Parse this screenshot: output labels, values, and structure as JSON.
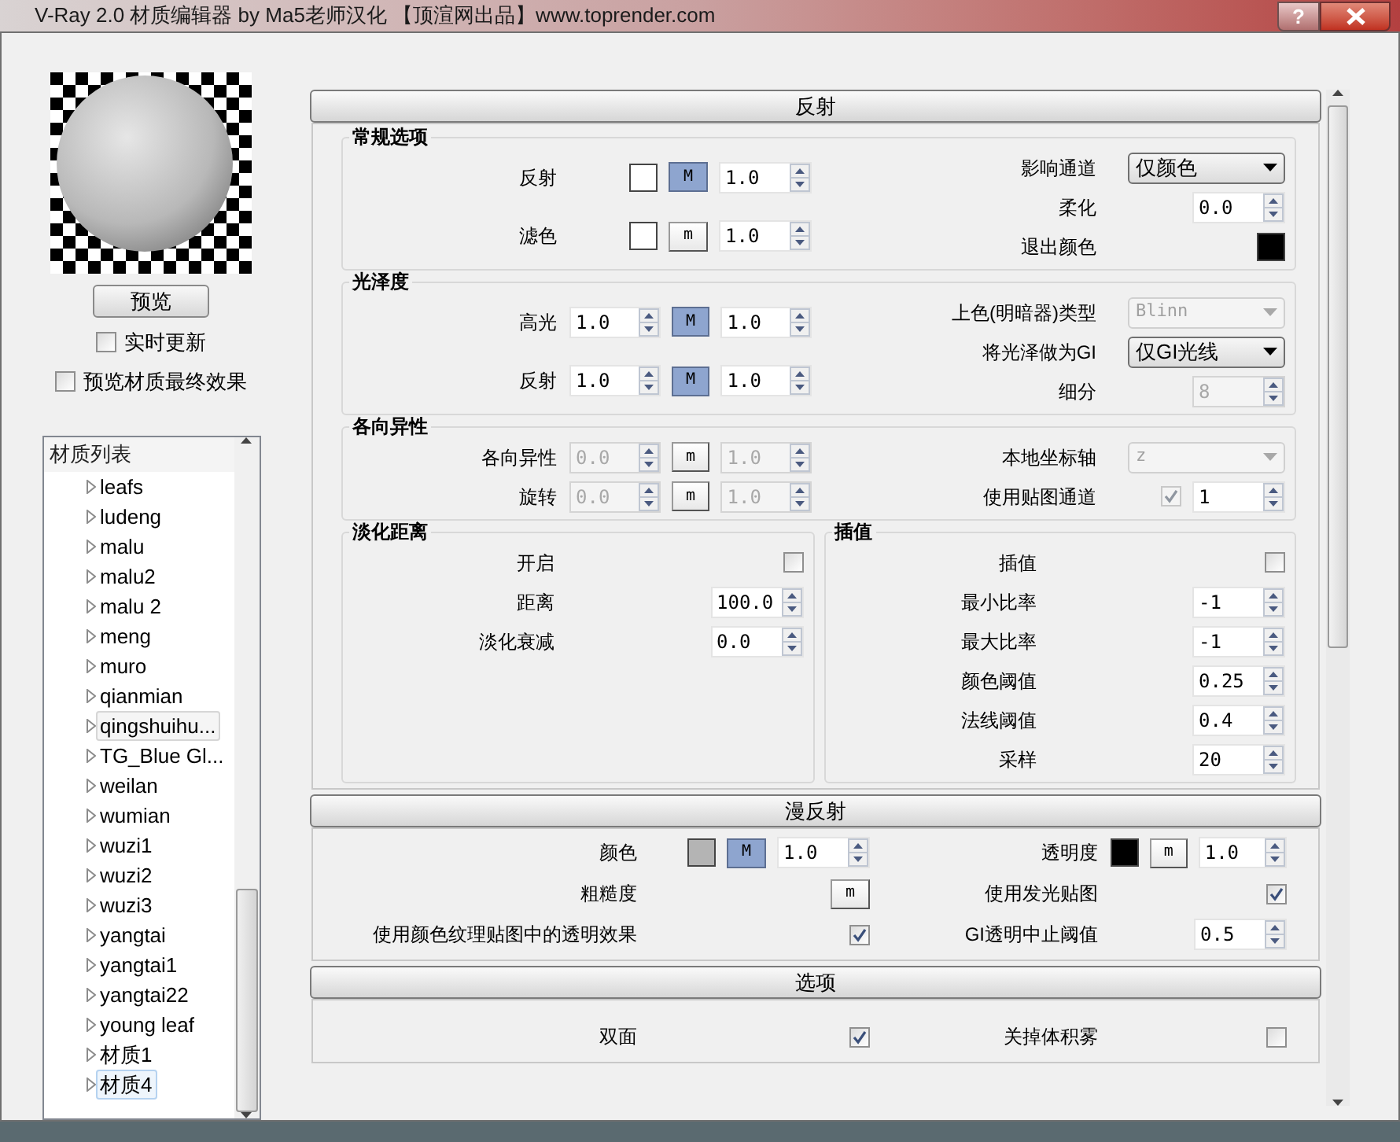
{
  "window": {
    "title": "V-Ray 2.0 材质编辑器 by Ma5老师汉化 【顶渲网出品】www.toprender.com",
    "help_button": "?"
  },
  "preview": {
    "button": "预览",
    "options": [
      {
        "label": "实时更新",
        "checked": false
      },
      {
        "label": "预览材质最终效果",
        "checked": false
      }
    ]
  },
  "material_list": {
    "header": "材质列表",
    "items": [
      {
        "label": "leafs",
        "selected": false,
        "hovered": false
      },
      {
        "label": "ludeng",
        "selected": false,
        "hovered": false
      },
      {
        "label": "malu",
        "selected": false,
        "hovered": false
      },
      {
        "label": "malu2",
        "selected": false,
        "hovered": false
      },
      {
        "label": "malu 2",
        "selected": false,
        "hovered": false
      },
      {
        "label": "meng",
        "selected": false,
        "hovered": false
      },
      {
        "label": "muro",
        "selected": false,
        "hovered": false
      },
      {
        "label": "qianmian",
        "selected": false,
        "hovered": false
      },
      {
        "label": "qingshuihu...",
        "selected": false,
        "hovered": true
      },
      {
        "label": "TG_Blue Gl...",
        "selected": false,
        "hovered": false
      },
      {
        "label": "weilan",
        "selected": false,
        "hovered": false
      },
      {
        "label": "wumian",
        "selected": false,
        "hovered": false
      },
      {
        "label": "wuzi1",
        "selected": false,
        "hovered": false
      },
      {
        "label": "wuzi2",
        "selected": false,
        "hovered": false
      },
      {
        "label": "wuzi3",
        "selected": false,
        "hovered": false
      },
      {
        "label": "yangtai",
        "selected": false,
        "hovered": false
      },
      {
        "label": "yangtai1",
        "selected": false,
        "hovered": false
      },
      {
        "label": "yangtai22",
        "selected": false,
        "hovered": false
      },
      {
        "label": "young leaf",
        "selected": false,
        "hovered": false
      },
      {
        "label": "材质1",
        "selected": false,
        "hovered": false
      },
      {
        "label": "材质4",
        "selected": true,
        "hovered": false
      }
    ]
  },
  "rollouts": [
    {
      "title": "反射",
      "group_rows": [
        [
          {
            "title": "常规选项",
            "left": [
              {
                "label": "反射",
                "controls": [
                  {
                    "kind": "swatch",
                    "color": "#ffffff"
                  },
                  {
                    "kind": "map_button",
                    "label": "M",
                    "active": true
                  },
                  {
                    "kind": "spinner",
                    "value": "1.0",
                    "disabled": false
                  }
                ]
              },
              {
                "label": "滤色",
                "controls": [
                  {
                    "kind": "swatch",
                    "color": "#ffffff"
                  },
                  {
                    "kind": "map_button",
                    "label": "m",
                    "active": false
                  },
                  {
                    "kind": "spinner",
                    "value": "1.0",
                    "disabled": false
                  }
                ]
              }
            ],
            "right": [
              {
                "label": "影响通道",
                "controls": [
                  {
                    "kind": "dropdown",
                    "value": "仅颜色",
                    "disabled": false
                  }
                ]
              },
              {
                "label": "柔化",
                "controls": [
                  {
                    "kind": "spinner",
                    "value": "0.0",
                    "disabled": false
                  }
                ]
              },
              {
                "label": "退出颜色",
                "controls": [
                  {
                    "kind": "swatch",
                    "color": "#000000"
                  }
                ]
              }
            ]
          }
        ],
        [
          {
            "title": "光泽度",
            "left": [
              {
                "label": "高光",
                "controls": [
                  {
                    "kind": "spinner",
                    "value": "1.0",
                    "disabled": false
                  },
                  {
                    "kind": "map_button",
                    "label": "M",
                    "active": true
                  },
                  {
                    "kind": "spinner",
                    "value": "1.0",
                    "disabled": false
                  }
                ]
              },
              {
                "label": "反射",
                "controls": [
                  {
                    "kind": "spinner",
                    "value": "1.0",
                    "disabled": false
                  },
                  {
                    "kind": "map_button",
                    "label": "M",
                    "active": true
                  },
                  {
                    "kind": "spinner",
                    "value": "1.0",
                    "disabled": false
                  }
                ]
              }
            ],
            "right": [
              {
                "label": "上色(明暗器)类型",
                "controls": [
                  {
                    "kind": "dropdown",
                    "value": "Blinn",
                    "disabled": true
                  }
                ]
              },
              {
                "label": "将光泽做为GI",
                "controls": [
                  {
                    "kind": "dropdown",
                    "value": "仅GI光线",
                    "disabled": false
                  }
                ]
              },
              {
                "label": "细分",
                "controls": [
                  {
                    "kind": "spinner",
                    "value": "8",
                    "disabled": true
                  }
                ]
              }
            ]
          }
        ],
        [
          {
            "title": "各向异性",
            "left": [
              {
                "label": "各向异性",
                "controls": [
                  {
                    "kind": "spinner",
                    "value": "0.0",
                    "disabled": true
                  },
                  {
                    "kind": "map_button",
                    "label": "m",
                    "active": false
                  },
                  {
                    "kind": "spinner",
                    "value": "1.0",
                    "disabled": true
                  }
                ]
              },
              {
                "label": "旋转",
                "controls": [
                  {
                    "kind": "spinner",
                    "value": "0.0",
                    "disabled": true
                  },
                  {
                    "kind": "map_button",
                    "label": "m",
                    "active": false
                  },
                  {
                    "kind": "spinner",
                    "value": "1.0",
                    "disabled": true
                  }
                ]
              }
            ],
            "right": [
              {
                "label": "本地坐标轴",
                "controls": [
                  {
                    "kind": "dropdown",
                    "value": "z",
                    "disabled": true
                  }
                ]
              },
              {
                "label": "使用贴图通道",
                "controls": [
                  {
                    "kind": "checkbox",
                    "checked": true,
                    "disabled": true
                  },
                  {
                    "kind": "spinner",
                    "value": "1",
                    "disabled": false
                  }
                ]
              }
            ]
          }
        ],
        [
          {
            "title": "淡化距离",
            "rows": [
              {
                "label": "开启",
                "controls": [
                  {
                    "kind": "checkbox",
                    "checked": false,
                    "disabled": false
                  }
                ]
              },
              {
                "label": "距离",
                "controls": [
                  {
                    "kind": "spinner",
                    "value": "100.0",
                    "disabled": false
                  }
                ]
              },
              {
                "label": "淡化衰减",
                "controls": [
                  {
                    "kind": "spinner",
                    "value": "0.0",
                    "disabled": false
                  }
                ]
              }
            ]
          },
          {
            "title": "插值",
            "rows": [
              {
                "label": "插值",
                "controls": [
                  {
                    "kind": "checkbox",
                    "checked": false,
                    "disabled": false
                  }
                ]
              },
              {
                "label": "最小比率",
                "controls": [
                  {
                    "kind": "spinner",
                    "value": "-1",
                    "disabled": false
                  }
                ]
              },
              {
                "label": "最大比率",
                "controls": [
                  {
                    "kind": "spinner",
                    "value": "-1",
                    "disabled": false
                  }
                ]
              },
              {
                "label": "颜色阈值",
                "controls": [
                  {
                    "kind": "spinner",
                    "value": "0.25",
                    "disabled": false
                  }
                ]
              },
              {
                "label": "法线阈值",
                "controls": [
                  {
                    "kind": "spinner",
                    "value": "0.4",
                    "disabled": false
                  }
                ]
              },
              {
                "label": "采样",
                "controls": [
                  {
                    "kind": "spinner",
                    "value": "20",
                    "disabled": false
                  }
                ]
              }
            ]
          }
        ]
      ]
    },
    {
      "title": "漫反射",
      "group_rows": [
        [
          {
            "left": [
              {
                "label": "颜色",
                "controls": [
                  {
                    "kind": "swatch",
                    "color": "#b4b4b4"
                  },
                  {
                    "kind": "map_button",
                    "label": "M",
                    "active": true
                  },
                  {
                    "kind": "spinner",
                    "value": "1.0",
                    "disabled": false
                  }
                ]
              },
              {
                "label": "粗糙度",
                "controls": [
                  {
                    "kind": "map_button",
                    "label": "m",
                    "active": false
                  }
                ]
              },
              {
                "label": "使用颜色纹理贴图中的透明效果",
                "controls": [
                  {
                    "kind": "checkbox",
                    "checked": true,
                    "disabled": false
                  }
                ]
              }
            ],
            "right": [
              {
                "label": "透明度",
                "controls": [
                  {
                    "kind": "swatch",
                    "color": "#000000"
                  },
                  {
                    "kind": "map_button",
                    "label": "m",
                    "active": false
                  },
                  {
                    "kind": "spinner",
                    "value": "1.0",
                    "disabled": false
                  }
                ]
              },
              {
                "label": "使用发光贴图",
                "controls": [
                  {
                    "kind": "checkbox",
                    "checked": true,
                    "disabled": false
                  }
                ]
              },
              {
                "label": "GI透明中止阈值",
                "controls": [
                  {
                    "kind": "spinner",
                    "value": "0.5",
                    "disabled": false
                  }
                ]
              }
            ]
          }
        ]
      ]
    },
    {
      "title": "选项",
      "group_rows": [
        [
          {
            "left": [
              {
                "label": "双面",
                "controls": [
                  {
                    "kind": "checkbox",
                    "checked": true,
                    "disabled": false
                  }
                ]
              }
            ],
            "right": [
              {
                "label": "关掉体积雾",
                "controls": [
                  {
                    "kind": "checkbox",
                    "checked": false,
                    "disabled": false
                  }
                ]
              }
            ]
          }
        ]
      ]
    }
  ]
}
